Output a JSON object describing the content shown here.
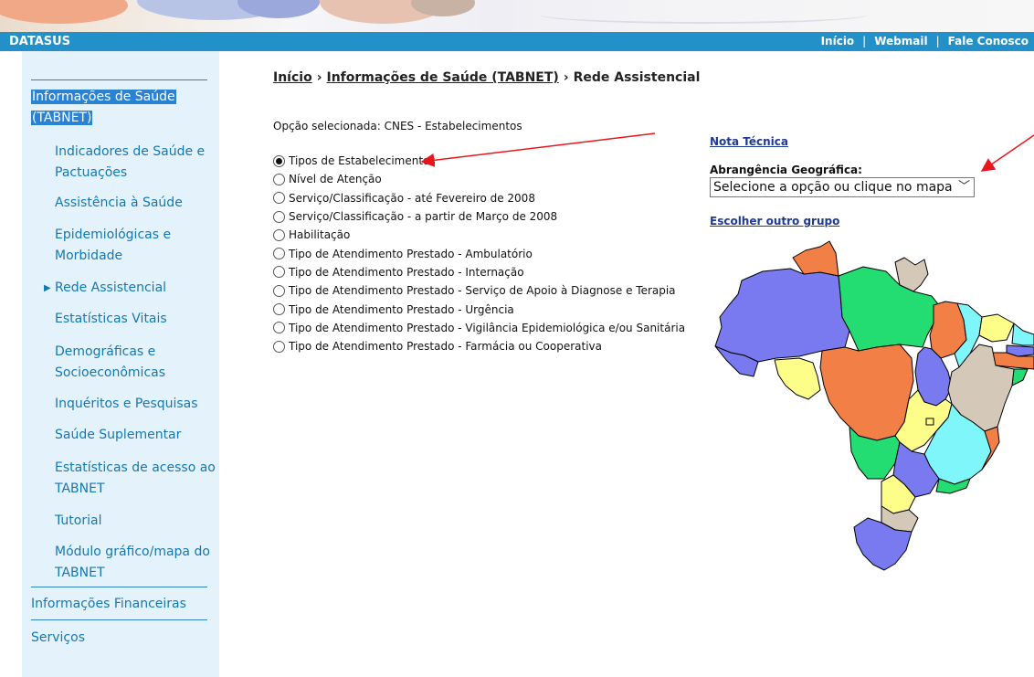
{
  "header": {
    "brand": "DATASUS",
    "links": [
      "Início",
      "Webmail",
      "Fale Conosco"
    ],
    "separator": "|"
  },
  "sidebar": {
    "section_title_line1": "Informações de Saúde",
    "section_title_line2": "(TABNET)",
    "items": [
      {
        "line1": "Indicadores de Saúde e",
        "line2": "Pactuações"
      },
      {
        "line1": "Assistência à Saúde",
        "line2": ""
      },
      {
        "line1": "Epidemiológicas e",
        "line2": "Morbidade"
      },
      {
        "line1": "Rede Assistencial",
        "line2": "",
        "active": true
      },
      {
        "line1": "Estatísticas Vitais",
        "line2": ""
      },
      {
        "line1": "Demográficas e",
        "line2": "Socioeconômicas"
      },
      {
        "line1": "Inquéritos e Pesquisas",
        "line2": ""
      },
      {
        "line1": "Saúde Suplementar",
        "line2": ""
      },
      {
        "line1": "Estatísticas de acesso ao",
        "line2": "TABNET"
      },
      {
        "line1": "Tutorial",
        "line2": ""
      },
      {
        "line1": "Módulo gráfico/mapa do",
        "line2": "TABNET"
      }
    ],
    "bottom_items": [
      "Informações Financeiras",
      "Serviços"
    ]
  },
  "breadcrumb": {
    "items": [
      "Início",
      "Informações de Saúde (TABNET)",
      "Rede Assistencial"
    ],
    "separator": "›"
  },
  "option_selected": "Opção selecionada: CNES - Estabelecimentos",
  "radio_options": [
    {
      "label": "Tipos de Estabelecimentos",
      "checked": true
    },
    {
      "label": "Nível de Atenção",
      "checked": false
    },
    {
      "label": "Serviço/Classificação - até Fevereiro de 2008",
      "checked": false
    },
    {
      "label": "Serviço/Classificação - a partir de Março de 2008",
      "checked": false
    },
    {
      "label": "Habilitação",
      "checked": false
    },
    {
      "label": "Tipo de Atendimento Prestado - Ambulatório",
      "checked": false
    },
    {
      "label": "Tipo de Atendimento Prestado - Internação",
      "checked": false
    },
    {
      "label": "Tipo de Atendimento Prestado - Serviço de Apoio à Diagnose e Terapia",
      "checked": false
    },
    {
      "label": "Tipo de Atendimento Prestado - Urgência",
      "checked": false
    },
    {
      "label": "Tipo de Atendimento Prestado - Vigilância Epidemiológica e/ou Sanitária",
      "checked": false
    },
    {
      "label": "Tipo de Atendimento Prestado - Farmácia ou Cooperativa",
      "checked": false
    }
  ],
  "right_panel": {
    "nota_tecnica": "Nota Técnica",
    "abrangencia_label": "Abrangência Geográfica:",
    "select_value": "Selecione a opção ou clique no mapa",
    "outro_grupo": "Escolher outro grupo"
  },
  "colors": {
    "topbar": "#2290c9",
    "sidebar_bg": "#e4f3fb",
    "link": "#1577b1",
    "highlight": "#2a82d2",
    "annotation_arrow": "#e8161c",
    "map_purple": "#7a7af0",
    "map_orange": "#f27f45",
    "map_green": "#23dd73",
    "map_tan": "#d4c9b8",
    "map_yellow": "#fdfd8a",
    "map_cyan": "#7ff7fa"
  }
}
